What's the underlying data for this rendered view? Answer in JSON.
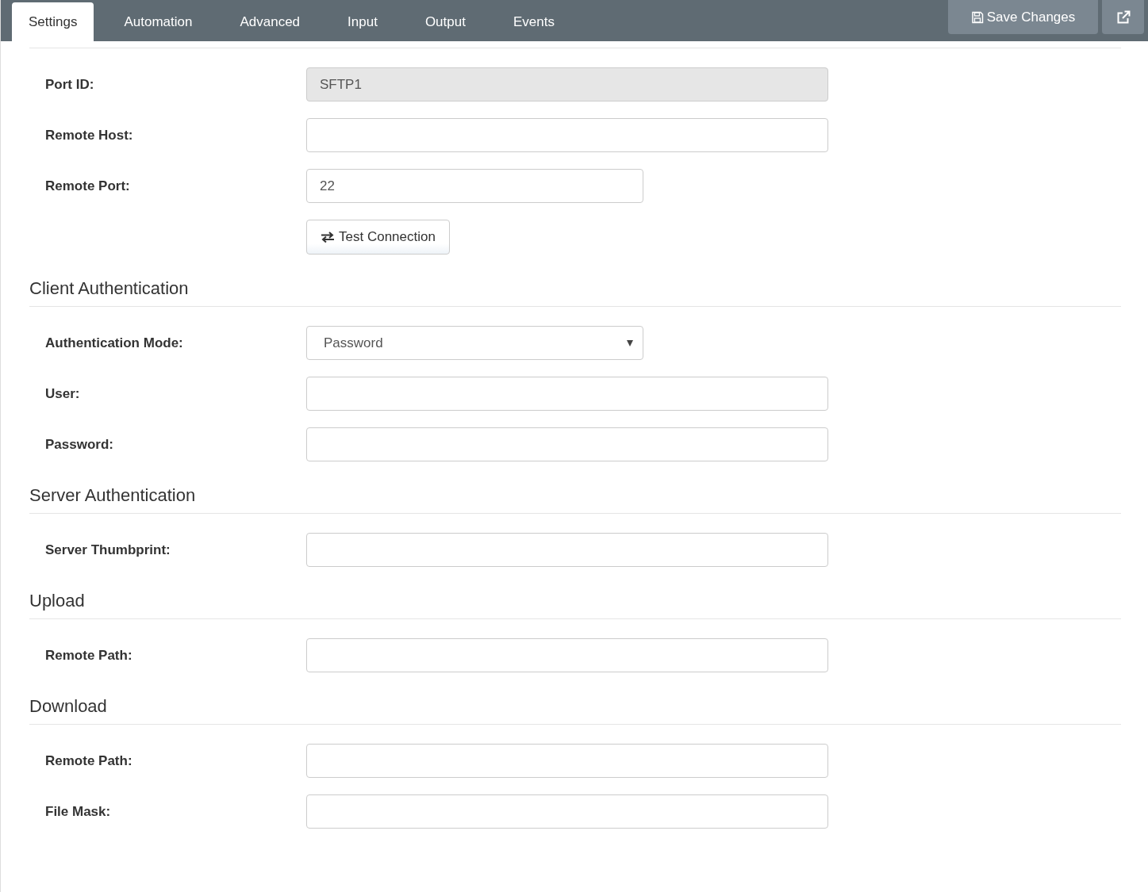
{
  "tabs": [
    {
      "label": "Settings",
      "selected": true
    },
    {
      "label": "Automation",
      "selected": false
    },
    {
      "label": "Advanced",
      "selected": false
    },
    {
      "label": "Input",
      "selected": false
    },
    {
      "label": "Output",
      "selected": false
    },
    {
      "label": "Events",
      "selected": false
    }
  ],
  "toolbar": {
    "save_button": "Save Changes"
  },
  "sections": [
    {
      "fields": [
        {
          "kind": "text",
          "label": "Port ID:",
          "value": "SFTP1",
          "disabled": true
        },
        {
          "kind": "text",
          "label": "Remote Host:",
          "disabled": false
        },
        {
          "kind": "number",
          "label": "Remote Port:",
          "value": "22",
          "disabled": false
        },
        {
          "kind": "button",
          "label": "Test Connection"
        }
      ]
    },
    {
      "title": "Client Authentication",
      "fields": [
        {
          "kind": "select",
          "label": "Authentication Mode:",
          "value": "Password"
        },
        {
          "kind": "text",
          "label": "User:",
          "disabled": false
        },
        {
          "kind": "text",
          "label": "Password:",
          "disabled": false
        }
      ]
    },
    {
      "title": "Server Authentication",
      "fields": [
        {
          "kind": "text",
          "label": "Server Thumbprint:",
          "disabled": false
        }
      ]
    },
    {
      "title": "Upload",
      "fields": [
        {
          "kind": "text",
          "label": "Remote Path:",
          "disabled": false
        }
      ]
    },
    {
      "title": "Download",
      "fields": [
        {
          "kind": "text",
          "label": "Remote Path:",
          "disabled": false
        },
        {
          "kind": "text",
          "label": "File Mask:",
          "disabled": false
        }
      ]
    }
  ]
}
